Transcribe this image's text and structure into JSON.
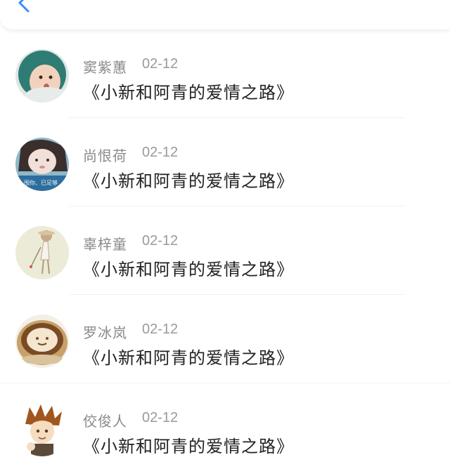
{
  "header": {
    "back_icon": "chevron-left-icon",
    "accent": "#3a8ef6"
  },
  "messages": [
    {
      "name": "窦紫蕙",
      "date": "02-12",
      "text": "《小新和阿青的爱情之路》",
      "avatar": "baby-avatar"
    },
    {
      "name": "尚恨荷",
      "date": "02-12",
      "text": "《小新和阿青的爱情之路》",
      "avatar": "girl-avatar"
    },
    {
      "name": "辜梓童",
      "date": "02-12",
      "text": "《小新和阿青的爱情之路》",
      "avatar": "sketch-girl-avatar"
    },
    {
      "name": "罗冰岚",
      "date": "02-12",
      "text": "《小新和阿青的爱情之路》",
      "avatar": "latte-art-avatar"
    },
    {
      "name": "佼俊人",
      "date": "02-12",
      "text": "《小新和阿青的爱情之路》",
      "avatar": "anime-boy-avatar"
    }
  ],
  "avatar_caption": "_围你、已足够"
}
